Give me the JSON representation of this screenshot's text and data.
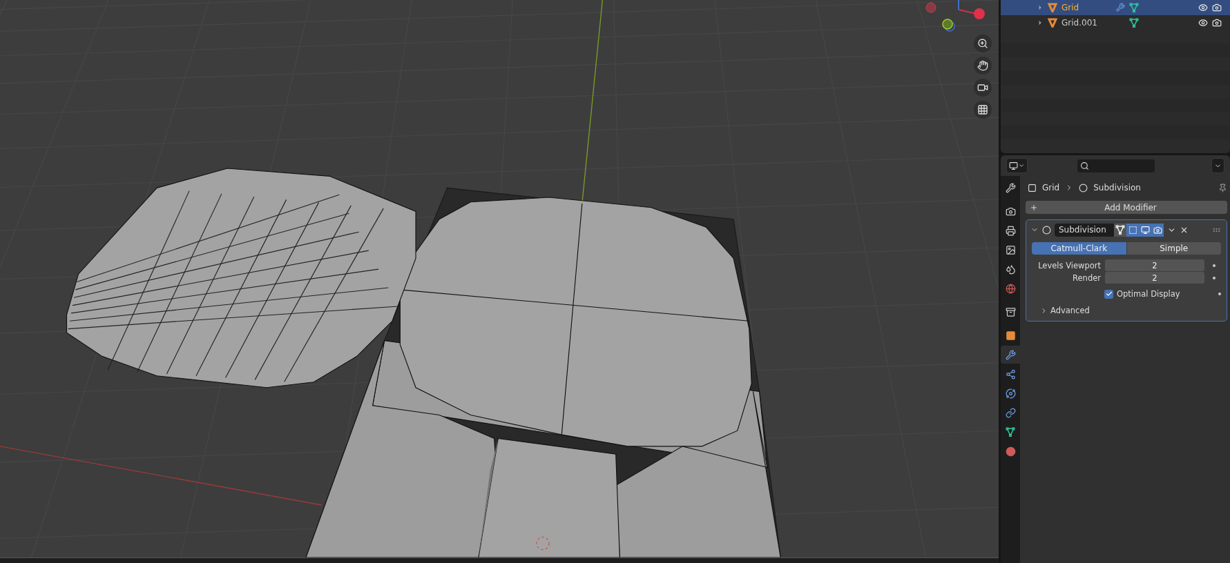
{
  "outliner": {
    "rows": [
      {
        "name": "Grid",
        "selected": true,
        "modifier": true
      },
      {
        "name": "Grid.001",
        "selected": false,
        "modifier": false
      }
    ]
  },
  "properties": {
    "tabs": [
      {
        "kind": "tool",
        "selected": false
      },
      {
        "kind": "render",
        "selected": false
      },
      {
        "kind": "output",
        "selected": false
      },
      {
        "kind": "view_layer",
        "selected": false
      },
      {
        "kind": "scene",
        "selected": false
      },
      {
        "kind": "world",
        "selected": false
      },
      {
        "kind": "collection",
        "selected": false
      },
      {
        "kind": "object",
        "selected": false
      },
      {
        "kind": "modifiers",
        "selected": true
      },
      {
        "kind": "particles",
        "selected": false
      },
      {
        "kind": "physics",
        "selected": false
      },
      {
        "kind": "constraints",
        "selected": false
      },
      {
        "kind": "data",
        "selected": false
      },
      {
        "kind": "material",
        "selected": false
      }
    ],
    "breadcrumb": [
      "Grid",
      "Subdivision"
    ],
    "add_modifier": "Add Modifier",
    "modifier": {
      "name": "Subdivision",
      "expanded": true,
      "toggles": [
        {
          "kind": "cage",
          "on": false
        },
        {
          "kind": "edit",
          "on": true
        },
        {
          "kind": "viewport",
          "on": true
        },
        {
          "kind": "render",
          "on": true
        }
      ],
      "methods": [
        {
          "label": "Catmull-Clark",
          "selected": true
        },
        {
          "label": "Simple",
          "selected": false
        }
      ],
      "fields": [
        {
          "label": "Levels Viewport",
          "value": "2"
        },
        {
          "label": "Render",
          "value": "2"
        }
      ],
      "optimal_display": {
        "label": "Optimal Display",
        "checked": true
      },
      "advanced": {
        "label": "Advanced",
        "expanded": false
      }
    }
  }
}
